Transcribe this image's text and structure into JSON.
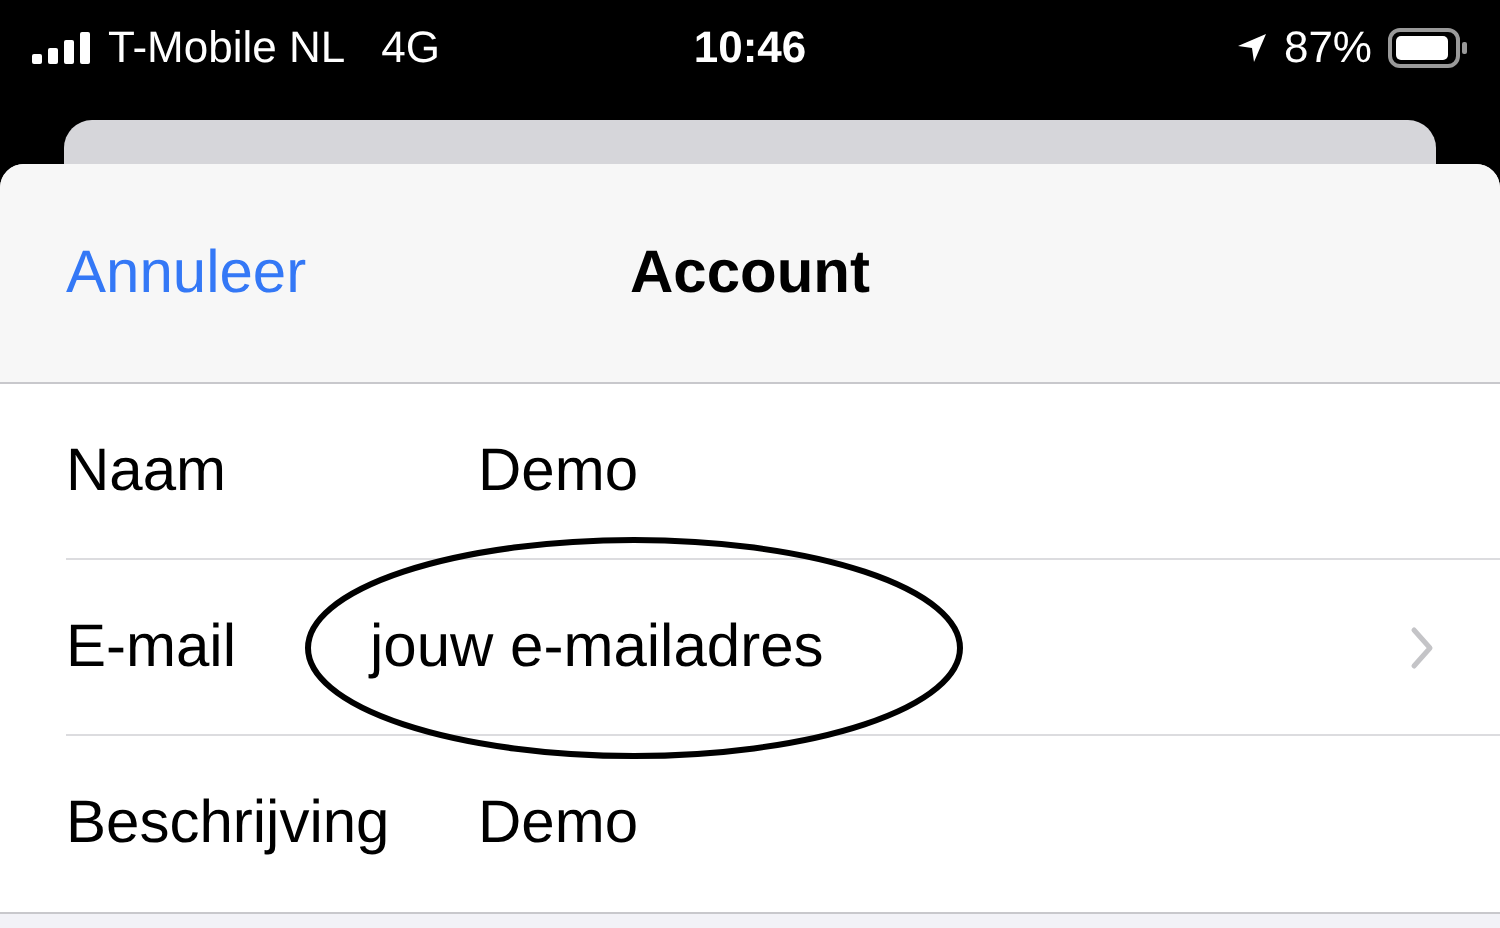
{
  "status_bar": {
    "carrier": "T-Mobile NL",
    "network": "4G",
    "time": "10:46",
    "battery": "87%"
  },
  "nav": {
    "cancel": "Annuleer",
    "title": "Account"
  },
  "rows": [
    {
      "label": "Naam",
      "value": "Demo",
      "chevron": false,
      "circled": false
    },
    {
      "label": "E-mail",
      "value": "jouw e-mailadres",
      "chevron": true,
      "circled": true
    },
    {
      "label": "Beschrijving",
      "value": "Demo",
      "chevron": false,
      "circled": false
    }
  ]
}
